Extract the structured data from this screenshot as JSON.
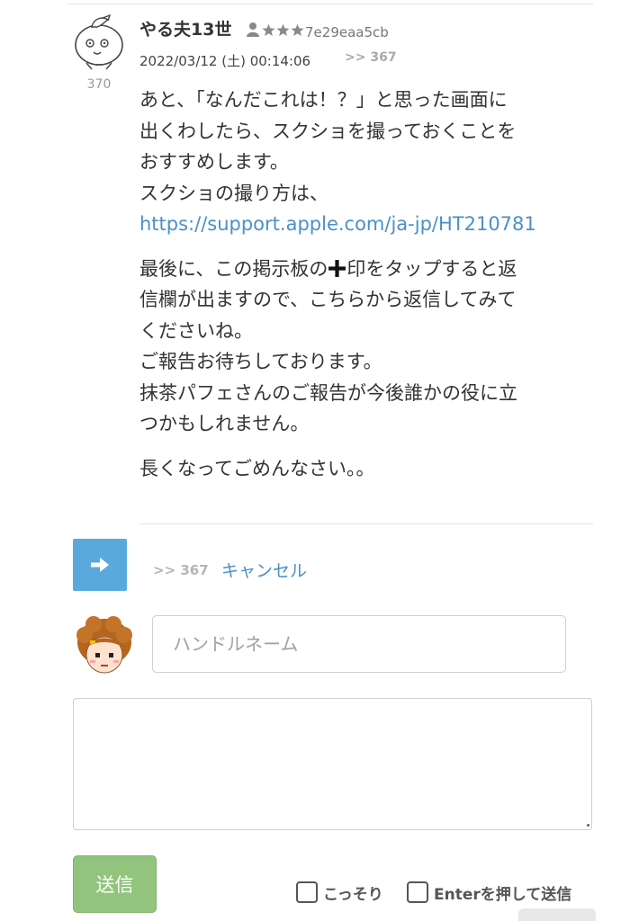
{
  "post": {
    "number": "370",
    "username": "やる夫13世",
    "rank_icons": [
      "person-rank-icon",
      "star-icon",
      "star-icon",
      "star-icon"
    ],
    "user_id": "7e29eaa5cb",
    "date": "2022/03/12 (土) 00:14:06",
    "reply_ref": ">> 367",
    "paragraphs": [
      {
        "lines": [
          "あと、「なんだこれは！？」と思った画面に",
          "出くわしたら、スクショを撮っておくことを",
          "おすすめします。",
          "スクショの撮り方は、"
        ],
        "link": "https://support.apple.com/ja-jp/HT210781"
      },
      {
        "line1_before": "最後に、この掲示板の",
        "line1_after": "印をタップすると返",
        "lines": [
          "信欄が出ますので、こちらから返信してみて",
          "くださいね。",
          "ご報告お待ちしております。",
          "抹茶パフェさんのご報告が今後誰かの役に立",
          "つかもしれません。"
        ]
      },
      {
        "lines": [
          "長くなってごめんなさい。。"
        ]
      }
    ]
  },
  "reply_form": {
    "arrow_icon": "arrow-right-icon",
    "reply_target": ">> 367",
    "cancel_label": "キャンセル",
    "handle_placeholder": "ハンドルネーム",
    "handle_value": "",
    "message_value": "",
    "submit_label": "送信",
    "options": [
      {
        "label": "こっそり",
        "checked": false
      },
      {
        "label": "Enterを押して送信",
        "checked": false
      }
    ]
  },
  "colors": {
    "link": "#4a90c8",
    "arrow_button": "#5aa9dc",
    "submit_button": "#93c47d",
    "muted": "#aaaaaa"
  }
}
